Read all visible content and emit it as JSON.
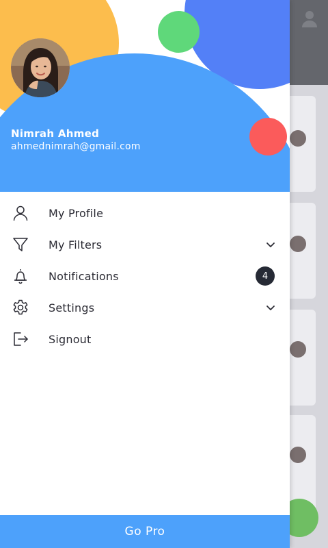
{
  "colors": {
    "accent_blue": "#4da1fb",
    "yellow": "#fcbd4d",
    "indigo": "#5380f7",
    "green": "#5fd87a",
    "red": "#fb5b5b",
    "badge_bg": "#262a35",
    "text_dark": "#2a2a33"
  },
  "user": {
    "name": "Nimrah Ahmed",
    "email": "ahmednimrah@gmail.com",
    "avatar_icon": "avatar"
  },
  "menu": {
    "items": [
      {
        "label": "My Profile",
        "icon": "user-icon"
      },
      {
        "label": "My Filters",
        "icon": "filter-icon",
        "expandable": true
      },
      {
        "label": "Notifications",
        "icon": "bell-icon",
        "badge": "4"
      },
      {
        "label": "Settings",
        "icon": "gear-icon",
        "expandable": true
      },
      {
        "label": "Signout",
        "icon": "signout-icon"
      }
    ]
  },
  "footer": {
    "go_pro_label": "Go Pro"
  }
}
